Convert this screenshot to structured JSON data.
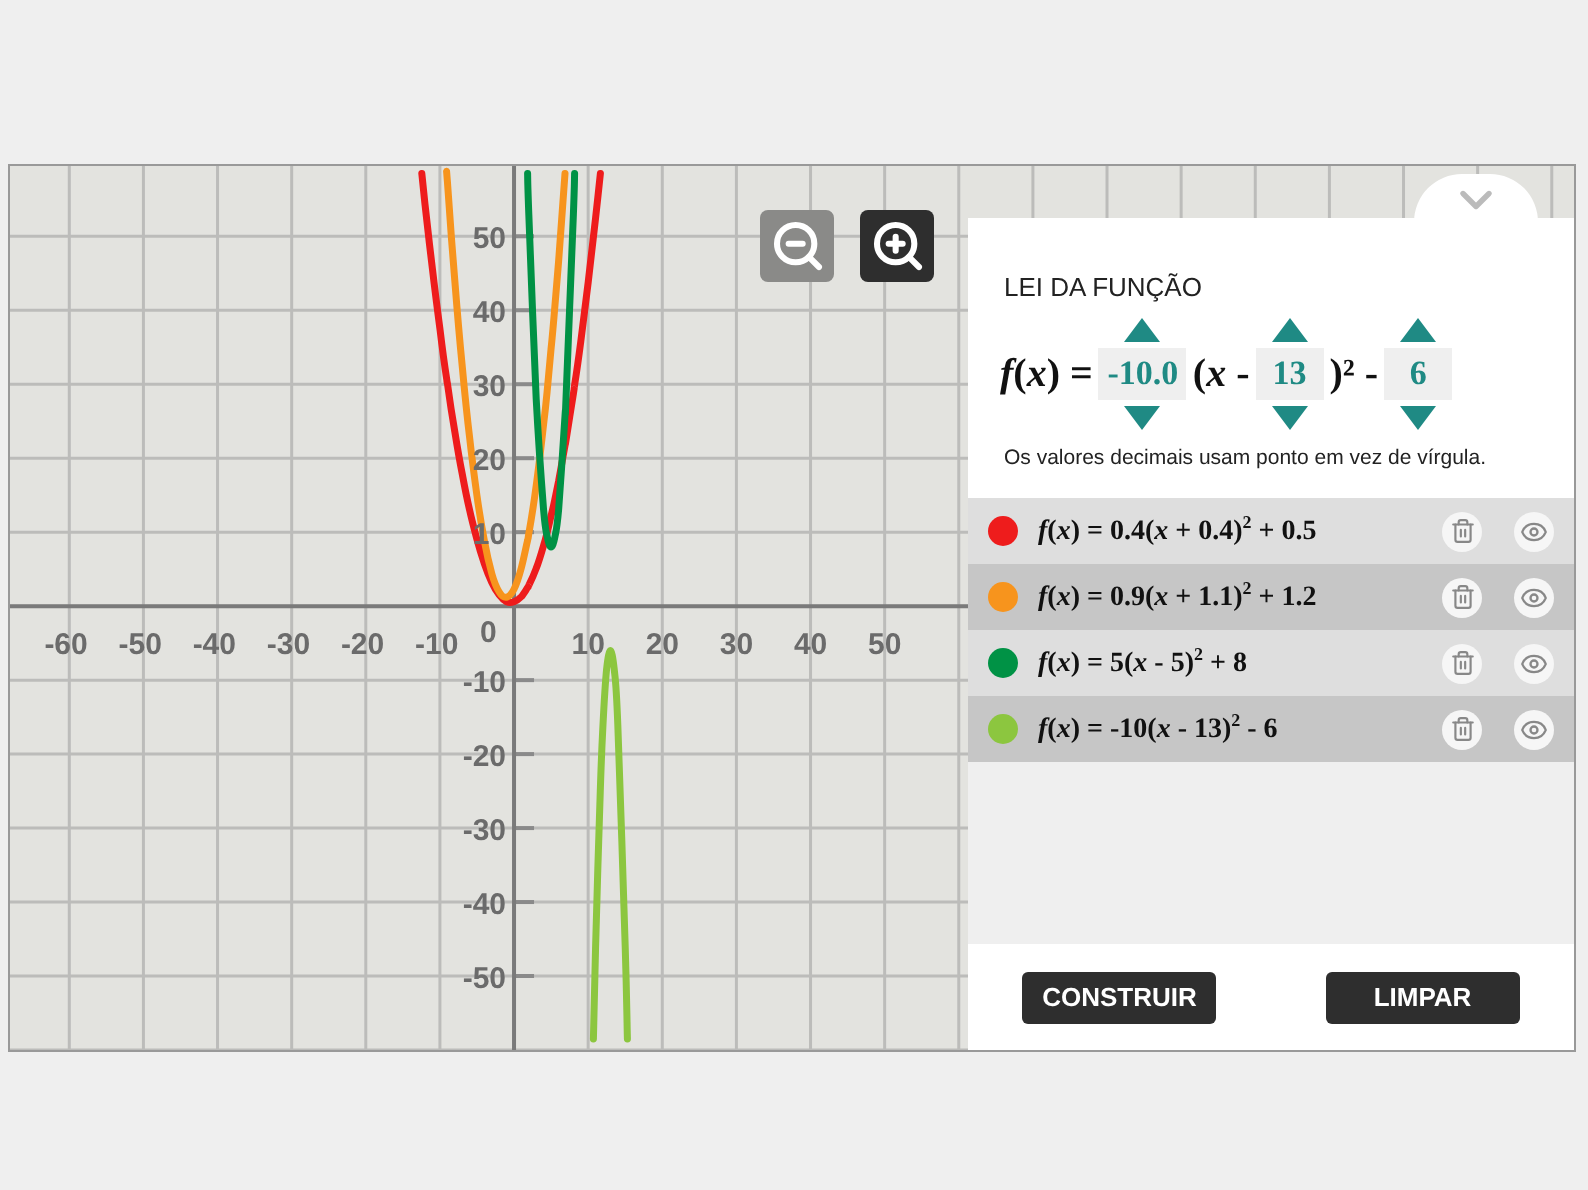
{
  "zoom_controls": [
    {
      "kind": "out",
      "selected": false
    },
    {
      "kind": "in",
      "selected": true
    }
  ],
  "graph": {
    "origin_label": "0",
    "chart_data": {
      "type": "line",
      "grid": true,
      "x": [
        -12.44,
        -12,
        -11,
        -10,
        -9.08,
        -9,
        -8,
        -7,
        -6,
        -5,
        -4,
        -3,
        -2,
        -1,
        0,
        1,
        1.82,
        2,
        3,
        4,
        4.5,
        5,
        5.5,
        6,
        6.88,
        7,
        8,
        8.18,
        9,
        10,
        10.71,
        11,
        11.64,
        12,
        12.5,
        13,
        13.5,
        14,
        15,
        15.29
      ],
      "series": [
        {
          "name": "*f*(*x*) = 0.4(*x* + 0.4)$^{2}$ + 0.5",
          "color": "#ee1c1c",
          "values": [
            58.5,
            54.3,
            45.4,
            37.4,
            30.6,
            30.1,
            23.6,
            17.9,
            13.0,
            9.0,
            5.7,
            3.2,
            1.5,
            0.6,
            0.6,
            1.3,
            2.5,
            2.8,
            5.1,
            8.2,
            10.1,
            12.2,
            14.4,
            16.9,
            21.7,
            22.4,
            28.7,
            29.9,
            35.8,
            43.8,
            49.9,
            52.5,
            58.5,
            null,
            null,
            null,
            null,
            null,
            null,
            null
          ]
        },
        {
          "name": "*f*(*x*) = 0.9(*x* + 1.1)$^{2}$ + 1.2",
          "color": "#f7941d",
          "values": [
            null,
            null,
            null,
            null,
            58.5,
            57.4,
            44.0,
            32.5,
            22.8,
            14.9,
            8.8,
            4.4,
            1.9,
            1.2,
            2.3,
            5.2,
            8.9,
            9.8,
            16.3,
            24.6,
            29.4,
            34.7,
            40.4,
            46.6,
            58.5,
            null,
            null,
            null,
            null,
            null,
            null,
            null,
            null,
            null,
            null,
            null,
            null,
            null,
            null,
            null
          ]
        },
        {
          "name": "*f*(*x*) = 5(*x* - 5)$^{2}$ + 8",
          "color": "#009245",
          "values": [
            null,
            null,
            null,
            null,
            null,
            null,
            null,
            null,
            null,
            null,
            null,
            null,
            null,
            null,
            null,
            null,
            58.5,
            53,
            28,
            13,
            9.3,
            8,
            9.3,
            13,
            25.7,
            28,
            53,
            58.5,
            null,
            null,
            null,
            null,
            null,
            null,
            null,
            null,
            null,
            null,
            null,
            null
          ]
        },
        {
          "name": "*f*(*x*) = -10(*x* - 13)$^{2}$ - 6",
          "color": "#8cc63f",
          "values": [
            null,
            null,
            null,
            null,
            null,
            null,
            null,
            null,
            null,
            null,
            null,
            null,
            null,
            null,
            null,
            null,
            null,
            null,
            null,
            null,
            null,
            null,
            null,
            null,
            null,
            null,
            null,
            null,
            null,
            null,
            -58.5,
            -46,
            -24.5,
            -16,
            -8.5,
            -6,
            -8.5,
            -16,
            -46,
            -58.5
          ]
        }
      ],
      "xlim": [
        -68,
        143
      ],
      "ylim": [
        -60,
        59.5
      ],
      "xticks": [
        -60,
        -50,
        -40,
        -30,
        -20,
        -10,
        10,
        20,
        30,
        40,
        50
      ],
      "yticks": [
        -50,
        -40,
        -30,
        -20,
        -10,
        10,
        20,
        30,
        40,
        50
      ]
    }
  },
  "panel": {
    "title": "LEI DA FUNÇÃO",
    "equation": {
      "lhs": "*f*(*x*) =",
      "parts": [
        {
          "kind": "field",
          "value": "-10.0"
        },
        {
          "kind": "text",
          "text": "(*x* -"
        },
        {
          "kind": "field",
          "value": "13"
        },
        {
          "kind": "text",
          "text": ")² -"
        },
        {
          "kind": "field",
          "value": "6"
        }
      ]
    },
    "note": "Os valores decimais usam ponto em vez de vírgula.",
    "buttons": [
      "CONSTRUIR",
      "LIMPAR"
    ]
  }
}
